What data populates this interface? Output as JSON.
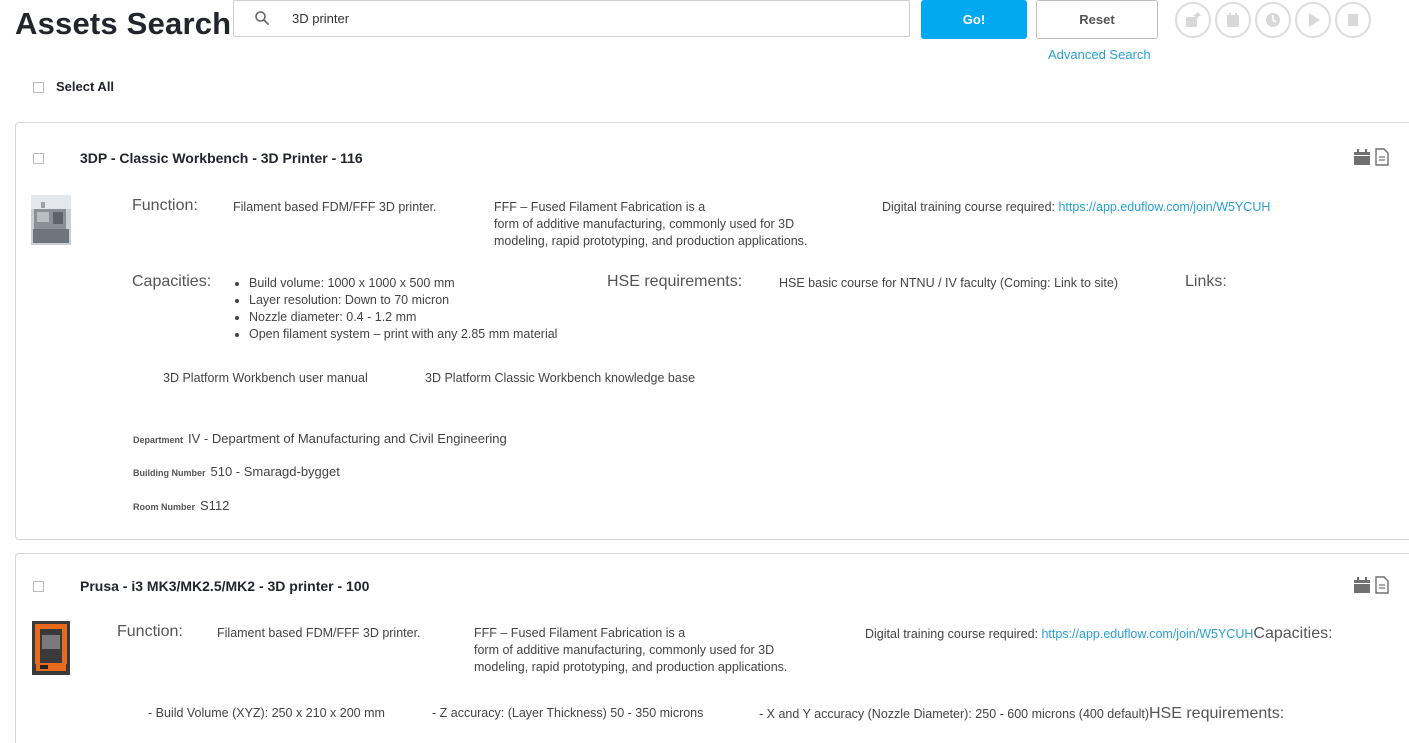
{
  "header": {
    "title": "Assets Search",
    "search_value": "3D printer",
    "go_label": "Go!",
    "reset_label": "Reset",
    "advanced_label": "Advanced Search",
    "tools": [
      "share-icon",
      "calendar-icon",
      "clock-icon",
      "play-icon",
      "stop-icon"
    ]
  },
  "select_all_label": "Select All",
  "colors": {
    "accent": "#00a8f0",
    "link": "#2a9fd6",
    "title": "#22252c"
  },
  "assets": [
    {
      "title": "3DP - Classic Workbench - 3D Printer - 116",
      "function_label": "Function:",
      "function_short": "Filament based FDM/FFF 3D printer.",
      "function_long_1": "FFF – Fused Filament Fabrication is a",
      "function_long_2": "form of additive manufacturing, commonly used for 3D",
      "function_long_3": "modeling, rapid prototyping, and production applications.",
      "training_text": "Digital training course required: ",
      "training_link": "https://app.eduflow.com/join/W5YCUH",
      "capacities_label": "Capacities:",
      "capacities": [
        "Build volume: 1000 x 1000 x 500 mm",
        "Layer resolution: Down to 70 micron",
        "Nozzle diameter: 0.4 - 1.2 mm",
        "Open filament system – print with any 2.85 mm material"
      ],
      "hse_label": "HSE requirements:",
      "hse_text": "HSE basic course for NTNU / IV faculty (Coming: Link to site)",
      "links_label": "Links:",
      "link_1": "3D Platform Workbench user manual",
      "link_2": "3D Platform Classic Workbench knowledge base",
      "department_label": "Department",
      "department_value": "IV - Department of Manufacturing and Civil Engineering",
      "building_label": "Building Number",
      "building_value": "510 - Smaragd-bygget",
      "room_label": "Room Number",
      "room_value": "S112"
    },
    {
      "title": "Prusa - i3 MK3/MK2.5/MK2 - 3D printer - 100",
      "function_label": "Function:",
      "function_short": "Filament based FDM/FFF 3D printer.",
      "function_long_1": "FFF – Fused Filament Fabrication is a",
      "function_long_2": "form of additive manufacturing, commonly used for 3D",
      "function_long_3": "modeling, rapid prototyping, and production applications.",
      "training_text": "Digital training course required: ",
      "training_link": "https://app.eduflow.com/join/W5YCUH",
      "capacities_label": "Capacities:",
      "spec_1": "- Build Volume (XYZ): 250 x 210 x 200 mm",
      "spec_2": "- Z accuracy: (Layer Thickness) 50 - 350 microns",
      "spec_3": "- X and Y accuracy (Nozzle Diameter): 250 - 600 microns (400 default)",
      "hse_label": "HSE requirements:"
    }
  ]
}
